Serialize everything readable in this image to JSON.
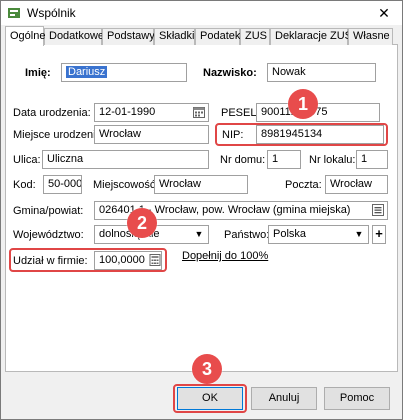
{
  "window": {
    "title": "Wspólnik",
    "close_glyph": "✕"
  },
  "tabs": [
    "Ogólne",
    "Dodatkowe",
    "Podstawy",
    "Składki",
    "Podatek",
    "ZUS",
    "Deklaracje ZUS",
    "Własne"
  ],
  "form": {
    "imie_label": "Imię:",
    "imie_value": "Dariusz",
    "nazwisko_label": "Nazwisko:",
    "nazwisko_value": "Nowak",
    "data_urodzenia_label": "Data urodzenia:",
    "data_urodzenia_value": "12-01-1990",
    "pesel_label": "PESEL:",
    "pesel_value": "90011216575",
    "miejsce_label": "Miejsce urodzenia:",
    "miejsce_value": "Wrocław",
    "nip_label": "NIP:",
    "nip_value": "8981945134",
    "ulica_label": "Ulica:",
    "ulica_value": "Uliczna",
    "nr_domu_label": "Nr domu:",
    "nr_domu_value": "1",
    "nr_lokalu_label": "Nr lokalu:",
    "nr_lokalu_value": "1",
    "kod_label": "Kod:",
    "kod_value": "50-000",
    "miejscowosc_label": "Miejscowość:",
    "miejscowosc_value": "Wrocław",
    "poczta_label": "Poczta:",
    "poczta_value": "Wrocław",
    "gmina_label": "Gmina/powiat:",
    "gmina_value": "026401 1 - Wrocław, pow. Wrocław (gmina miejska)",
    "wojewodztwo_label": "Województwo:",
    "wojewodztwo_value": "dolnośląskie",
    "panstwo_label": "Państwo:",
    "panstwo_value": "Polska",
    "udzial_label": "Udział w firmie:",
    "udzial_value": "100,0000",
    "dopelnij_link": "Dopełnij do 100%"
  },
  "badges": [
    "1",
    "2",
    "3"
  ],
  "buttons": {
    "ok": "OK",
    "anuluj": "Anuluj",
    "pomoc": "Pomoc"
  },
  "colors": {
    "highlight": "#e04646",
    "badge": "#e84c4c",
    "selection": "#3a73cf"
  }
}
